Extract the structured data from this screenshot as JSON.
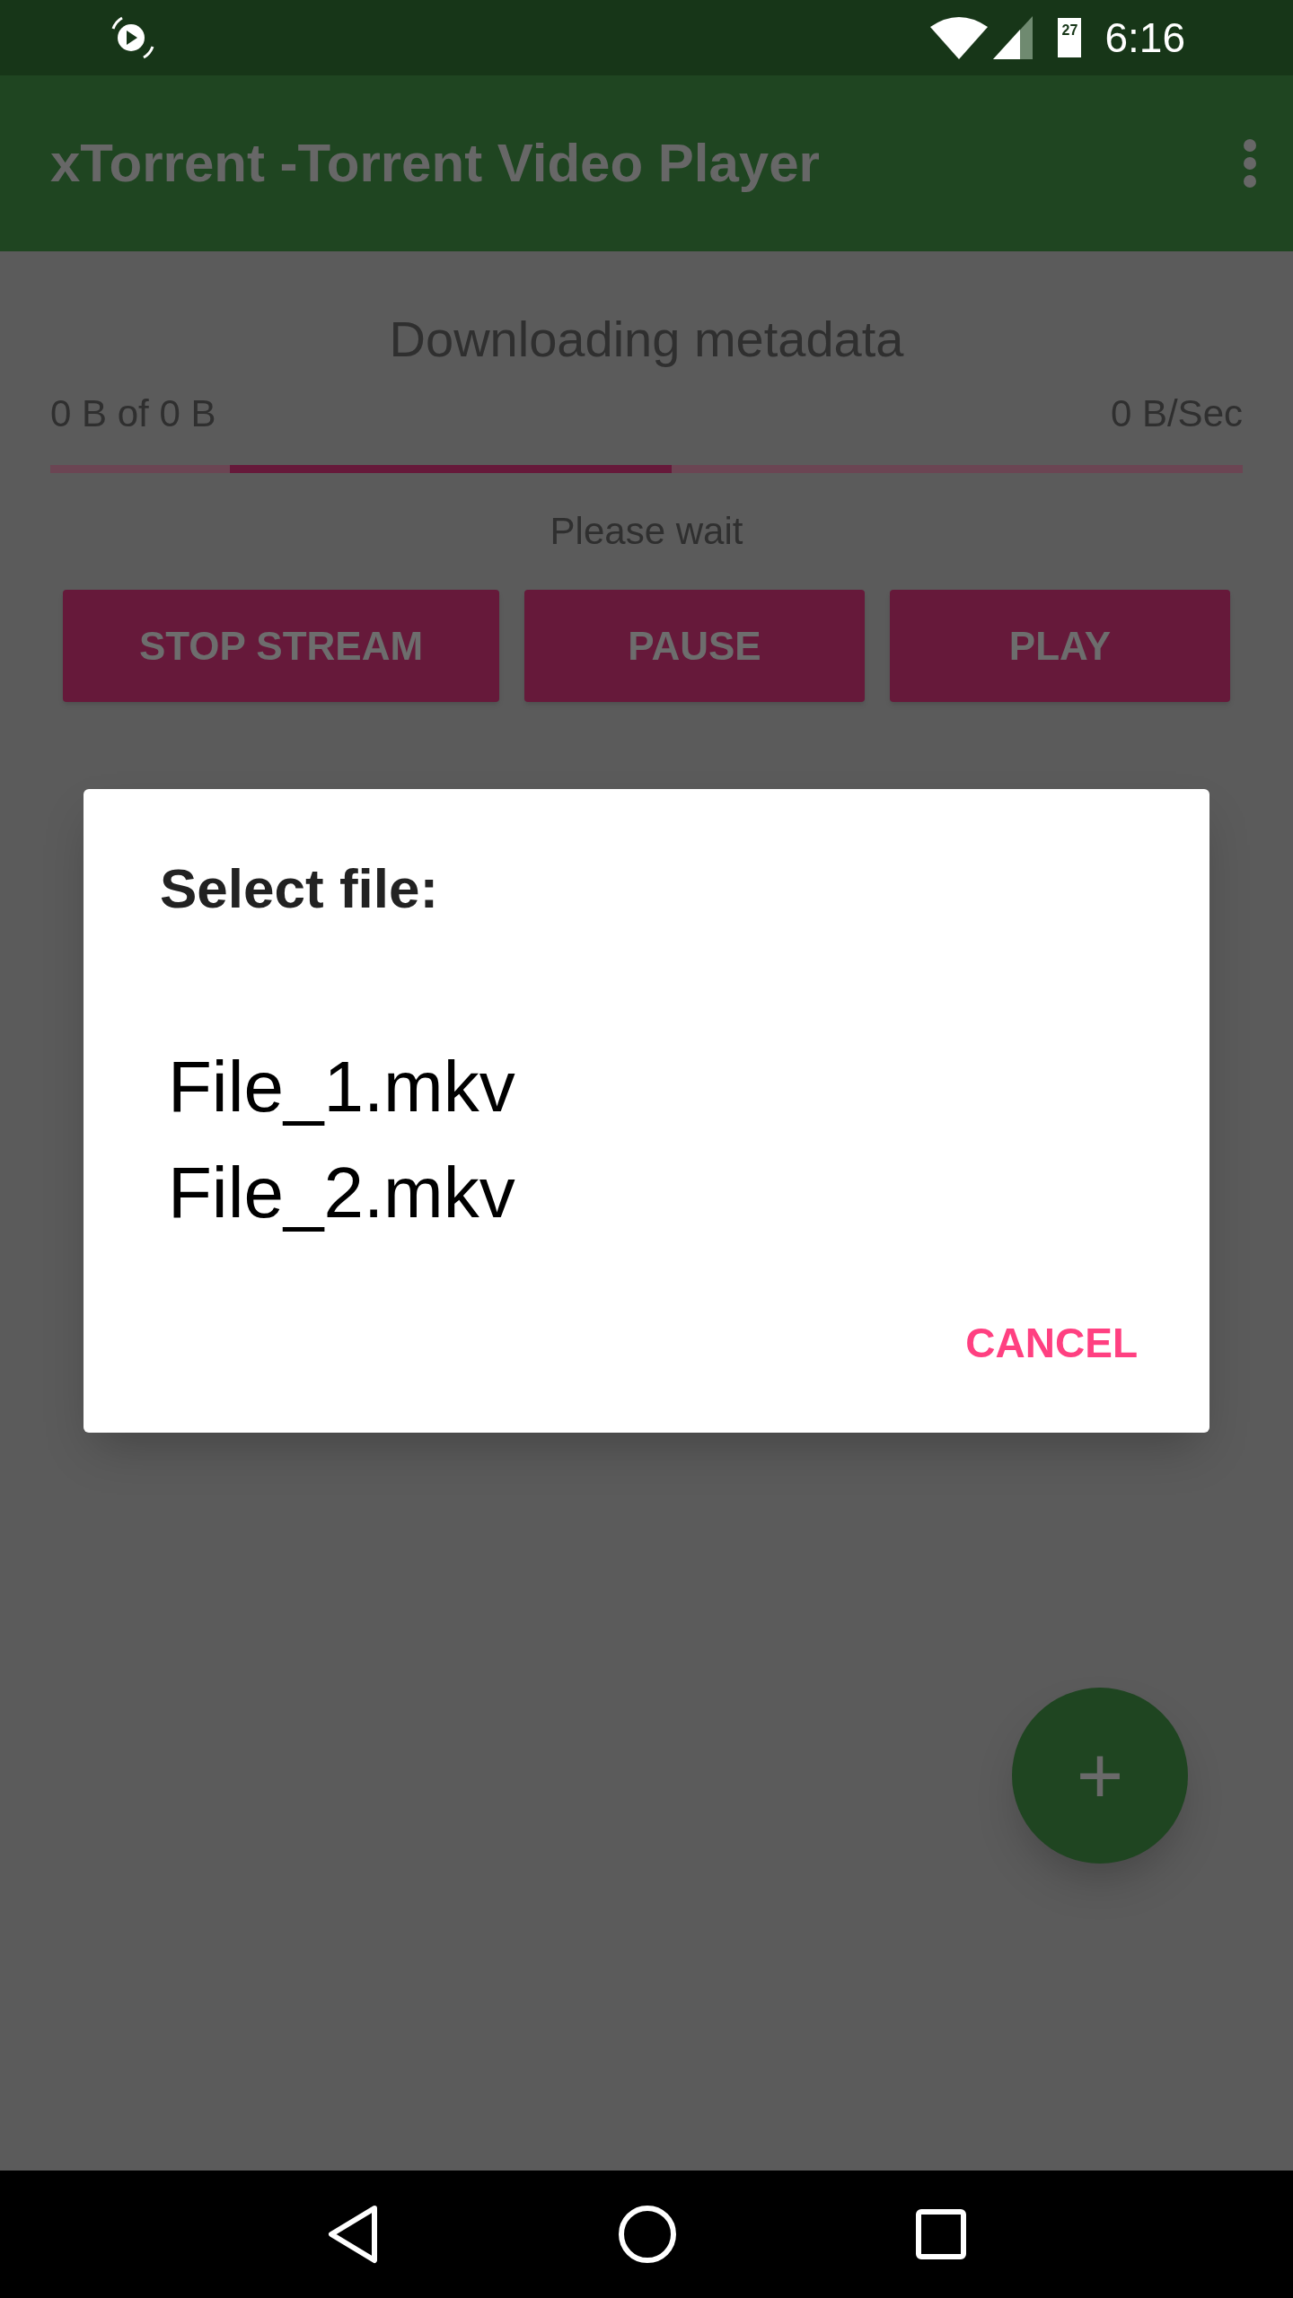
{
  "status_bar": {
    "time": "6:16",
    "battery": "27"
  },
  "app_bar": {
    "title": "xTorrent -Torrent Video Player"
  },
  "download": {
    "heading": "Downloading metadata",
    "size": "0 B of 0 B",
    "speed": "0 B/Sec",
    "progress": {
      "indeterminate": true
    },
    "message": "Please wait"
  },
  "buttons": [
    "STOP STREAM",
    "PAUSE",
    "PLAY"
  ],
  "dialog": {
    "title": "Select file:",
    "files": [
      "File_1.mkv",
      "File_2.mkv"
    ],
    "cancel": "CANCEL"
  },
  "fab": {
    "label": "+"
  }
}
